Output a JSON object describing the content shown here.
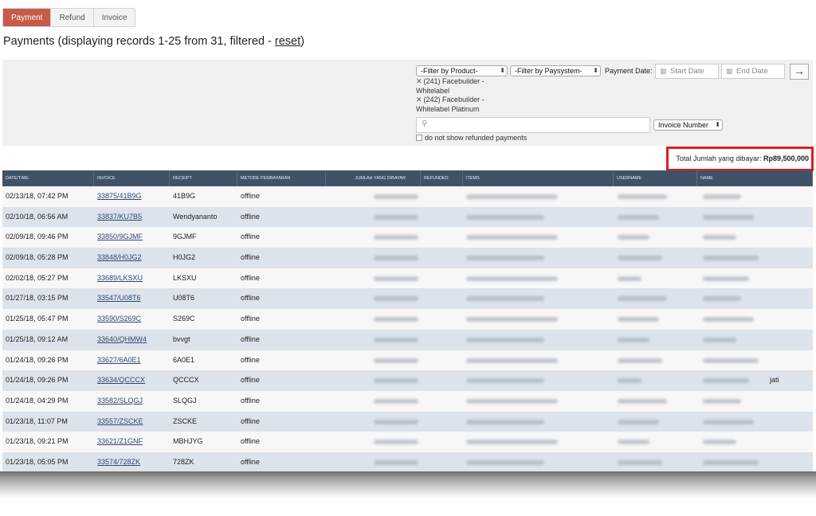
{
  "tabs": [
    {
      "label": "Payment",
      "active": true
    },
    {
      "label": "Refund",
      "active": false
    },
    {
      "label": "Invoice",
      "active": false
    }
  ],
  "title": {
    "text": "Payments (displaying records 1-25 from 31, filtered - ",
    "reset_label": "reset",
    "suffix": ")"
  },
  "filter": {
    "product_select": "-Filter by Product-",
    "paysystem_select": "-Filter by Paysystem-",
    "payment_date_label": "Payment Date:",
    "start_date_placeholder": "Start Date",
    "end_date_placeholder": "End Date",
    "go_icon": "arrow-right-icon",
    "selected_products": [
      {
        "label": "(241) Facebuilder - Whitelabel"
      },
      {
        "label": "(242) Facebuilder - Whitelabel Platinum"
      }
    ],
    "search_placeholder": "",
    "search_value": "",
    "search_field_select": "Invoice Number",
    "hide_refunded_label": "do not show refunded payments",
    "hide_refunded_checked": false
  },
  "total": {
    "label": "Total Jumlah yang dibayar: ",
    "value": "Rp89,500,000",
    "highlight_color": "#e21c1c"
  },
  "table": {
    "header_color": "#3f5268",
    "columns": [
      "Date/Time",
      "Invoice",
      "Receipt",
      "Metode Pembayaran",
      "Jumlah yang dibayar",
      "Refunded",
      "Items",
      "Username",
      "Name"
    ],
    "rows": [
      {
        "date": "02/13/18, 07:42 PM",
        "invoice": "33875/41B9G",
        "receipt": "41B9G",
        "method": "offline"
      },
      {
        "date": "02/10/18, 06:56 AM",
        "invoice": "33837/KU7B5",
        "receipt": "Wendyananto",
        "method": "offline"
      },
      {
        "date": "02/09/18, 09:46 PM",
        "invoice": "33850/9GJMF",
        "receipt": "9GJMF",
        "method": "offline"
      },
      {
        "date": "02/09/18, 05:28 PM",
        "invoice": "33848/H0JG2",
        "receipt": "H0JG2",
        "method": "offline"
      },
      {
        "date": "02/02/18, 05:27 PM",
        "invoice": "33689/LKSXU",
        "receipt": "LKSXU",
        "method": "offline"
      },
      {
        "date": "01/27/18, 03:15 PM",
        "invoice": "33547/U08T6",
        "receipt": "U08T6",
        "method": "offline"
      },
      {
        "date": "01/25/18, 05:47 PM",
        "invoice": "33590/S269C",
        "receipt": "S269C",
        "method": "offline"
      },
      {
        "date": "01/25/18, 09:12 AM",
        "invoice": "33640/QHMW4",
        "receipt": "bvvgt",
        "method": "offline"
      },
      {
        "date": "01/24/18, 09:26 PM",
        "invoice": "33627/6A0E1",
        "receipt": "6A0E1",
        "method": "offline"
      },
      {
        "date": "01/24/18, 09:26 PM",
        "invoice": "33634/QCCCX",
        "receipt": "QCCCX",
        "method": "offline",
        "name_suffix": "jati"
      },
      {
        "date": "01/24/18, 04:29 PM",
        "invoice": "33582/SLQGJ",
        "receipt": "SLQGJ",
        "method": "offline"
      },
      {
        "date": "01/23/18, 11:07 PM",
        "invoice": "33557/ZSCKE",
        "receipt": "ZSCKE",
        "method": "offline"
      },
      {
        "date": "01/23/18, 09:21 PM",
        "invoice": "33621/Z1GNF",
        "receipt": "MBHJYG",
        "method": "offline"
      },
      {
        "date": "01/23/18, 05:05 PM",
        "invoice": "33574/728ZK",
        "receipt": "728ZK",
        "method": "offline"
      }
    ]
  }
}
